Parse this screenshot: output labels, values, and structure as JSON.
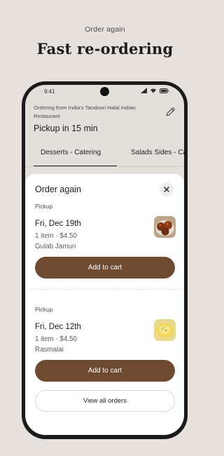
{
  "promo": {
    "kicker": "Order again",
    "headline": "Fast re-ordering"
  },
  "status_bar": {
    "time": "9:41"
  },
  "header": {
    "ordering_from": "Ordering from India's Tandoori Halal Indian Restaurant",
    "pickup_eta": "Pickup in 15 min"
  },
  "tabs": [
    {
      "label": "Desserts - Catering",
      "active": true
    },
    {
      "label": "Salads Sides - Ca",
      "active": false
    }
  ],
  "sheet": {
    "title": "Order again",
    "orders": [
      {
        "type": "Pickup",
        "date": "Fri, Dec 19th",
        "meta": "1 item · $4.50",
        "item": "Gulab Jamun",
        "button": "Add to cart"
      },
      {
        "type": "Pickup",
        "date": "Fri, Dec 12th",
        "meta": "1 item · $4.50",
        "item": "Rasmalai",
        "button": "Add to cart"
      }
    ],
    "view_all": "View all orders"
  },
  "colors": {
    "background": "#e6e1dd",
    "brand_button": "#6e4a31",
    "phone_frame": "#1b1b1b"
  }
}
